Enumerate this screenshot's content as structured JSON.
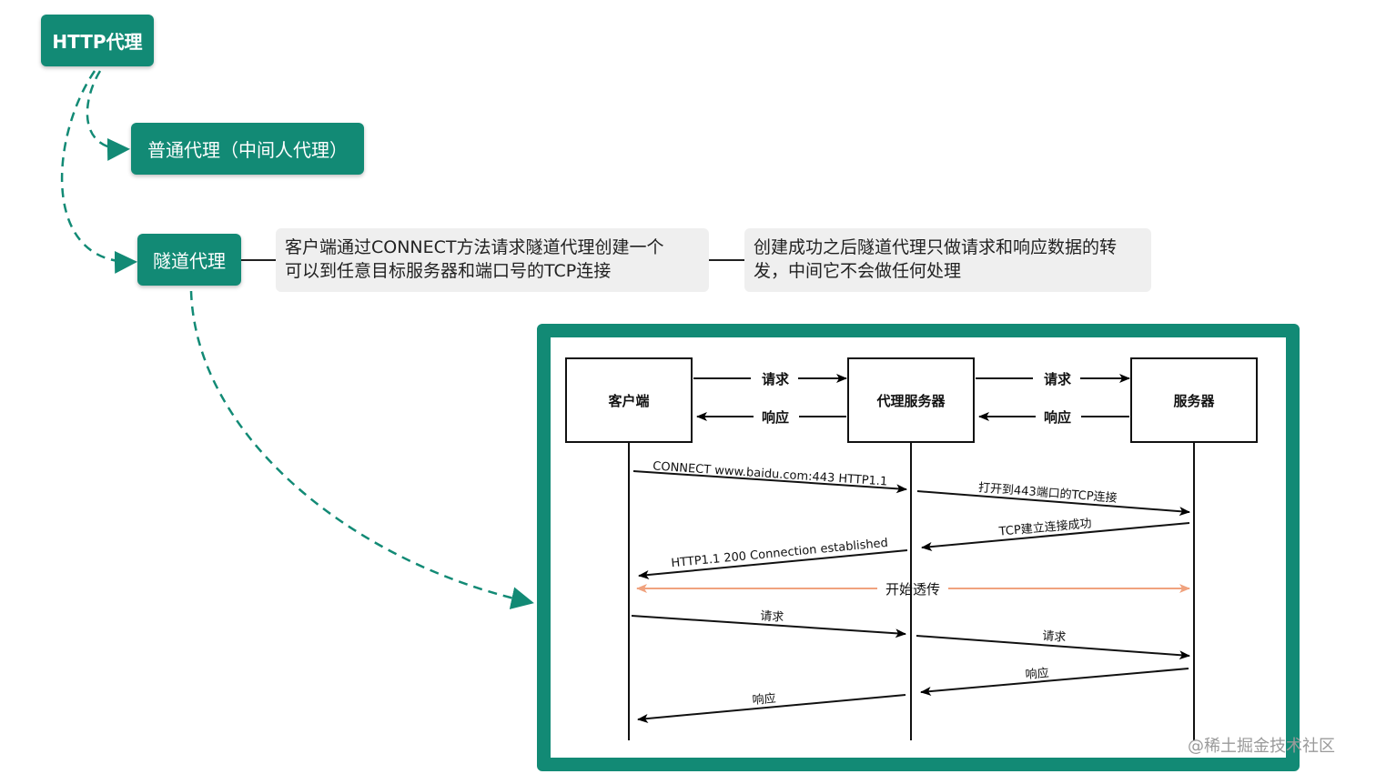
{
  "mindmap": {
    "root": "HTTP代理",
    "child_normal": "普通代理（中间人代理）",
    "child_tunnel": "隧道代理",
    "note1": [
      "客户端通过CONNECT方法请求隧道代理创建一个",
      "可以到任意目标服务器和端口号的TCP连接"
    ],
    "note2": [
      "创建成功之后隧道代理只做请求和响应数据的转",
      "发，中间它不会做任何处理"
    ]
  },
  "sequence": {
    "actors": [
      "客户端",
      "代理服务器",
      "服务器"
    ],
    "top_request": "请求",
    "top_response": "响应",
    "messages": [
      "CONNECT www.baidu.com:443 HTTP1.1",
      "打开到443端口的TCP连接",
      "TCP建立连接成功",
      "HTTP1.1 200 Connection established",
      "开始透传",
      "请求",
      "请求",
      "响应",
      "响应"
    ]
  },
  "watermark": "@稀土掘金技术社区",
  "colors": {
    "accent": "#128a75",
    "note_bg": "#efefef",
    "transparent_line": "#f0a27e"
  }
}
